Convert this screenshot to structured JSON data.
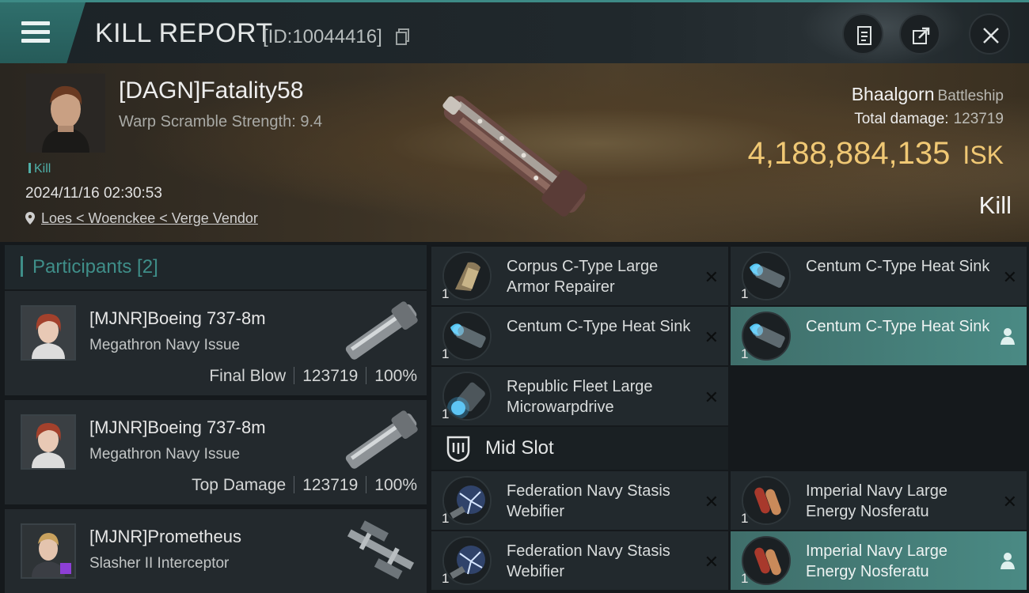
{
  "header": {
    "title": "KILL REPORT",
    "report_id": "[ID:10044416]"
  },
  "victim": {
    "name": "[DAGN]Fatality58",
    "scramble": "Warp Scramble Strength: 9.4",
    "badge": "Kill",
    "timestamp": "2024/11/16 02:30:53",
    "location": "Loes < Woenckee < Verge Vendor",
    "ship_name": "Bhaalgorn",
    "ship_class": "Battleship",
    "total_damage_label": "Total damage:",
    "total_damage": "123719",
    "isk_value": "4,188,884,135",
    "isk_unit": "ISK",
    "result": "Kill"
  },
  "participants": {
    "header": "Participants [2]",
    "items": [
      {
        "name": "[MJNR]Boeing 737-8m",
        "ship": "Megathron Navy Issue",
        "role": "Final Blow",
        "damage": "123719",
        "percent": "100%"
      },
      {
        "name": "[MJNR]Boeing 737-8m",
        "ship": "Megathron Navy Issue",
        "role": "Top Damage",
        "damage": "123719",
        "percent": "100%"
      },
      {
        "name": "[MJNR]Prometheus",
        "ship": "Slasher II Interceptor"
      }
    ]
  },
  "modules": {
    "low": [
      {
        "name": "Corpus C-Type Large Armor Repairer",
        "qty": "1",
        "status": "destroyed",
        "icon": "armor-repairer-icon"
      },
      {
        "name": "Centum C-Type Heat Sink",
        "qty": "1",
        "status": "destroyed",
        "icon": "heat-sink-icon"
      },
      {
        "name": "Centum C-Type Heat Sink",
        "qty": "1",
        "status": "destroyed",
        "icon": "heat-sink-icon"
      },
      {
        "name": "Centum C-Type Heat Sink",
        "qty": "1",
        "status": "dropped",
        "icon": "heat-sink-icon"
      },
      {
        "name": "Republic Fleet Large Microwarpdrive",
        "qty": "1",
        "status": "destroyed",
        "icon": "microwarpdrive-icon"
      }
    ],
    "mid_slot_label": "Mid Slot",
    "mid": [
      {
        "name": "Federation Navy Stasis Webifier",
        "qty": "1",
        "status": "destroyed",
        "icon": "stasis-webifier-icon"
      },
      {
        "name": "Imperial Navy Large Energy Nosferatu",
        "qty": "1",
        "status": "destroyed",
        "icon": "nosferatu-icon"
      },
      {
        "name": "Federation Navy Stasis Webifier",
        "qty": "1",
        "status": "destroyed",
        "icon": "stasis-webifier-icon"
      },
      {
        "name": "Imperial Navy Large Energy Nosferatu",
        "qty": "1",
        "status": "dropped",
        "icon": "nosferatu-icon"
      }
    ]
  },
  "colors": {
    "accent": "#3f8e89",
    "isk": "#f0c874",
    "dropped_highlight": "#4a8a84"
  }
}
